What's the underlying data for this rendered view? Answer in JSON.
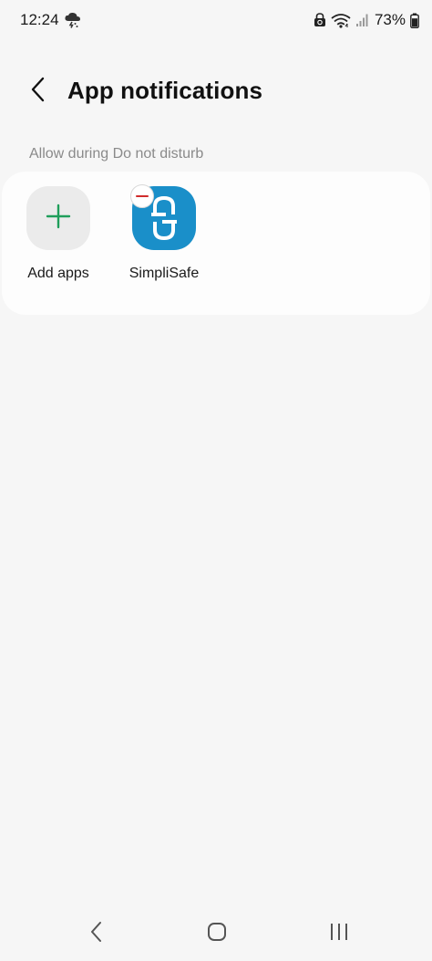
{
  "status_bar": {
    "time": "12:24",
    "battery_percent": "73%",
    "icons": [
      "weather-storm-icon",
      "vpn-icon",
      "wifi-icon",
      "signal-icon",
      "battery-icon"
    ]
  },
  "header": {
    "title": "App notifications",
    "back_icon": "chevron-left-icon"
  },
  "section": {
    "label": "Allow during Do not disturb"
  },
  "apps": [
    {
      "label": "Add apps",
      "icon": "plus-icon",
      "accent": "#1f9e5b"
    },
    {
      "label": "SimpliSafe",
      "icon": "simplisafe-logo",
      "background": "#1a8fc9",
      "badge": "remove-icon",
      "badge_color": "#d02b2b"
    }
  ],
  "nav_bar": {
    "buttons": [
      "back-icon",
      "home-icon",
      "recents-icon"
    ]
  }
}
